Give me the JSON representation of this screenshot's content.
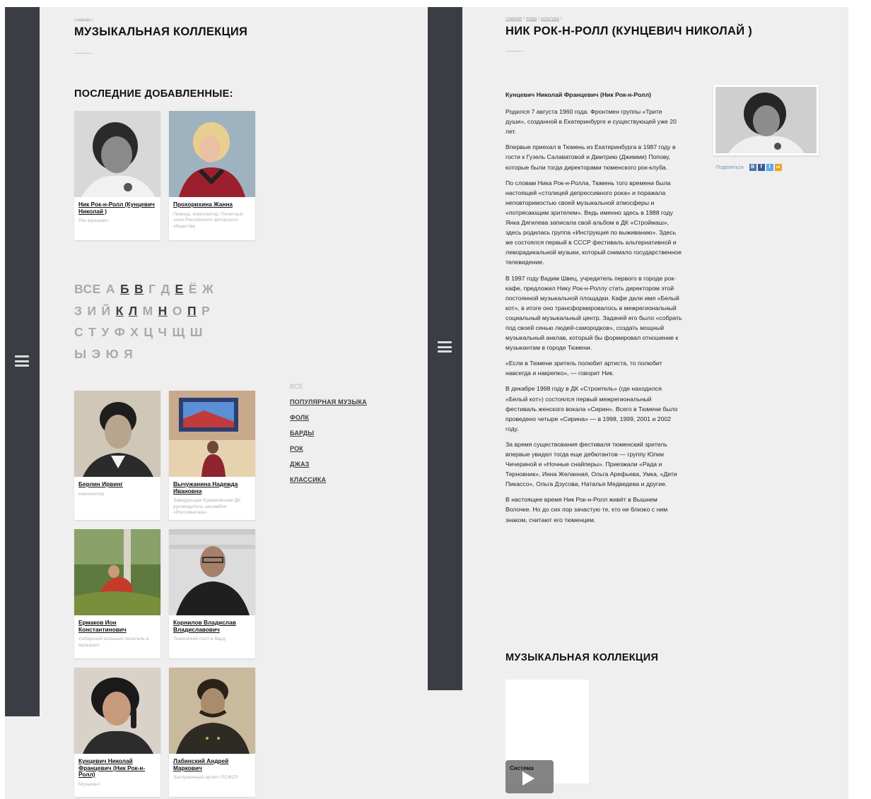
{
  "left": {
    "breadcrumb": "главная /",
    "title": "МУЗЫКАЛЬНАЯ КОЛЛЕКЦИЯ",
    "recent_title": "ПОСЛЕДНИЕ ДОБАВЛЕННЫЕ:",
    "recent": [
      {
        "name": "Ник Рок-н-Ролл (Кунцевич Николай )",
        "desc": "Рок музыкант"
      },
      {
        "name": "Прохорихина Жанна",
        "desc": "Певица, композитор. Почетный член Российского авторского общества"
      }
    ],
    "alphabet_rows": [
      [
        {
          "t": "ВСЕ",
          "on": false
        },
        {
          "t": "А",
          "on": false
        },
        {
          "t": "Б",
          "on": true
        },
        {
          "t": "В",
          "on": true
        },
        {
          "t": "Г",
          "on": false
        },
        {
          "t": "Д",
          "on": false
        },
        {
          "t": "Е",
          "on": true
        },
        {
          "t": "Ё",
          "on": false
        },
        {
          "t": "Ж",
          "on": false
        }
      ],
      [
        {
          "t": "З",
          "on": false
        },
        {
          "t": "И",
          "on": false
        },
        {
          "t": "Й",
          "on": false
        },
        {
          "t": "К",
          "on": true
        },
        {
          "t": "Л",
          "on": true
        },
        {
          "t": "М",
          "on": false
        },
        {
          "t": "Н",
          "on": true
        },
        {
          "t": "О",
          "on": false
        },
        {
          "t": "П",
          "on": true
        },
        {
          "t": "Р",
          "on": false
        }
      ],
      [
        {
          "t": "С",
          "on": false
        },
        {
          "t": "Т",
          "on": false
        },
        {
          "t": "У",
          "on": false
        },
        {
          "t": "Ф",
          "on": false
        },
        {
          "t": "Х",
          "on": false
        },
        {
          "t": "Ц",
          "on": false
        },
        {
          "t": "Ч",
          "on": false
        },
        {
          "t": "Щ",
          "on": false
        },
        {
          "t": "Ш",
          "on": false
        }
      ],
      [
        {
          "t": "Ы",
          "on": false
        },
        {
          "t": "Э",
          "on": false
        },
        {
          "t": "Ю",
          "on": false
        },
        {
          "t": "Я",
          "on": false
        }
      ]
    ],
    "genres": [
      {
        "label": "ВСЕ",
        "active": false
      },
      {
        "label": "ПОПУЛЯРНАЯ МУЗЫКА",
        "active": true
      },
      {
        "label": "ФОЛК",
        "active": true
      },
      {
        "label": "БАРДЫ",
        "active": true
      },
      {
        "label": "РОК",
        "active": true
      },
      {
        "label": "ДЖАЗ",
        "active": true
      },
      {
        "label": "КЛАССИКА",
        "active": true
      }
    ],
    "people": [
      {
        "name": "Берлин Ирвинг",
        "desc": "композитор"
      },
      {
        "name": "Вычужанина Надежда Ивановна",
        "desc": "Заведующая Ермаковским ДК, руководитель ансамбля «Россияночка»"
      },
      {
        "name": "Ермаков Ион Константинович",
        "desc": "Сибирский вольный писатель и музыкант"
      },
      {
        "name": "Корнилов Владислав Владиславович",
        "desc": "Тюменский поэт и бард."
      },
      {
        "name": "Кунцевич Николай Францевич (Ник Рок-н-Ролл)",
        "desc": "Музыкант"
      },
      {
        "name": "Лабинский Андрей Маркович",
        "desc": "Заслуженный артист РСФСР"
      }
    ]
  },
  "right": {
    "breadcrumb": [
      "главная",
      "люди",
      "культура"
    ],
    "title": "НИК РОК-Н-РОЛЛ (КУНЦЕВИЧ НИКОЛАЙ )",
    "lead": "Кунцевич Николай Францевич (Ник Рок-н-Ролл)",
    "paragraphs": [
      "Родился 7 августа 1960 года. Фронтмен группы «Трите души», созданной в Екатеринбурге и существующей уже 20 лет.",
      "Впервые приехал в Тюмень из Екатеринбурга в 1987 году в гости к Гузель Салаватовой и Дмитрию (Джимми) Попову, которые были тогда директорами тюменского рок-клуба.",
      "По словам Ника Рок-н-Ролла, Тюмень того времени была настоящей «столицей депрессивного рока» и поражала неповторимостью своей музыкальной атмосферы и «потрясающим зрителем». Ведь именно здесь в 1988 году Янка Дягилева записала свой альбом в ДК «Строймаш», здесь родилась группа «Инструкция по выживанию». Здесь же состоялся первый в СССР фестиваль альтернативной и леворадикальной музыки, который снимало государственное телевидение.",
      "В 1997 году Вадим Швец, учредитель первого в городе рок-кафе, предложил Нику Рок-н-Роллу стать директором этой постоянной музыкальной площадки. Кафе дали имя «Белый кот», в итоге оно трансформировалось в межрегиональный социальный музыкальный центр. Задачей его было «собрать под своей сенью людей-самородков», создать мощный музыкальный анклав, который бы формировал отношение к музыкантам в городе Тюмени.",
      "«Если в Тюмени зритель полюбит артиста, то полюбит навсегда и накрепко», — говорит Ник.",
      "В декабре 1998 году в ДК «Строитель» (где находился «Белый кот») состоялся первый межрегиональный фестиваль женского вокала «Сирин». Всего в Тюмени было проведено четыре «Сирина» — в 1998, 1999, 2001 и 2002 году.",
      "За время существования фестиваля тюменский зритель впервые увидел тогда еще дебютантов — группу Юлии Чичериной и «Ночные снайперы». Приезжали «Рада и Терновник», Инна Желанная, Ольга Арефьева, Умка, «Дети Пикассо», Ольга Дзусова, Наталья Медведева и другие.",
      "В настоящее время Ник Рок-н-Ролл живёт в Вышнем Волочке. Но до сих пор зачастую те, кто не близко с ним знаком, считают его тюменцем."
    ],
    "share_label": "Поделиться",
    "share_buttons": [
      "В",
      "f",
      "t",
      "ok"
    ],
    "collection_title": "МУЗЫКАЛЬНАЯ КОЛЛЕКЦИЯ",
    "video_title": "Система"
  },
  "colors": {
    "rail": "#3a3d44",
    "page_bg": "#efefef",
    "muted": "#a9a9a9",
    "share_link": "#6e8fbf"
  }
}
